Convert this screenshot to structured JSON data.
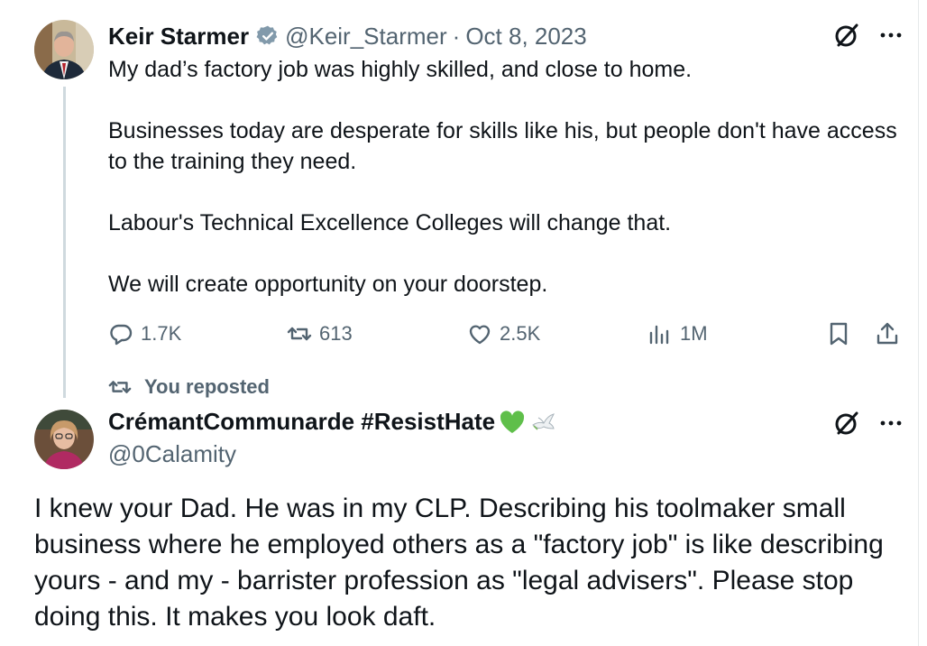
{
  "main_tweet": {
    "author_name": "Keir Starmer",
    "handle": "@Keir_Starmer",
    "separator": "·",
    "date": "Oct 8, 2023",
    "paragraphs": [
      "My dad’s factory job was highly skilled, and close to home.",
      "Businesses today are desperate for skills like his, but people don't have access to the training they need.",
      "Labour's Technical Excellence Colleges will change that.",
      "We will create opportunity on your doorstep."
    ],
    "stats": {
      "replies": "1.7K",
      "reposts": "613",
      "likes": "2.5K",
      "views": "1M"
    }
  },
  "repost_banner": "You reposted",
  "reply": {
    "author_name": "CrémantCommunarde #ResistHate",
    "handle": "@0Calamity",
    "text": "I knew your Dad. He was in my CLP. Describing his toolmaker small business where he employed others as a \"factory job\" is like describing yours - and my - barrister profession as \"legal advisers\".  Please stop doing this. It makes you look daft."
  },
  "icons": {
    "verified": "verified-badge-icon",
    "grok": "grok-icon",
    "more": "more-icon",
    "reply": "reply-icon",
    "repost": "repost-icon",
    "like": "heart-icon",
    "views": "views-icon",
    "bookmark": "bookmark-icon",
    "share": "share-icon",
    "emoji_green_heart": "green-heart-emoji",
    "emoji_dove": "dove-emoji"
  },
  "colors": {
    "text": "#0f1419",
    "secondary": "#536471",
    "thread_line": "#cfd9de",
    "verified_gray": "#829aab",
    "green_heart": "#5fbf4a"
  }
}
